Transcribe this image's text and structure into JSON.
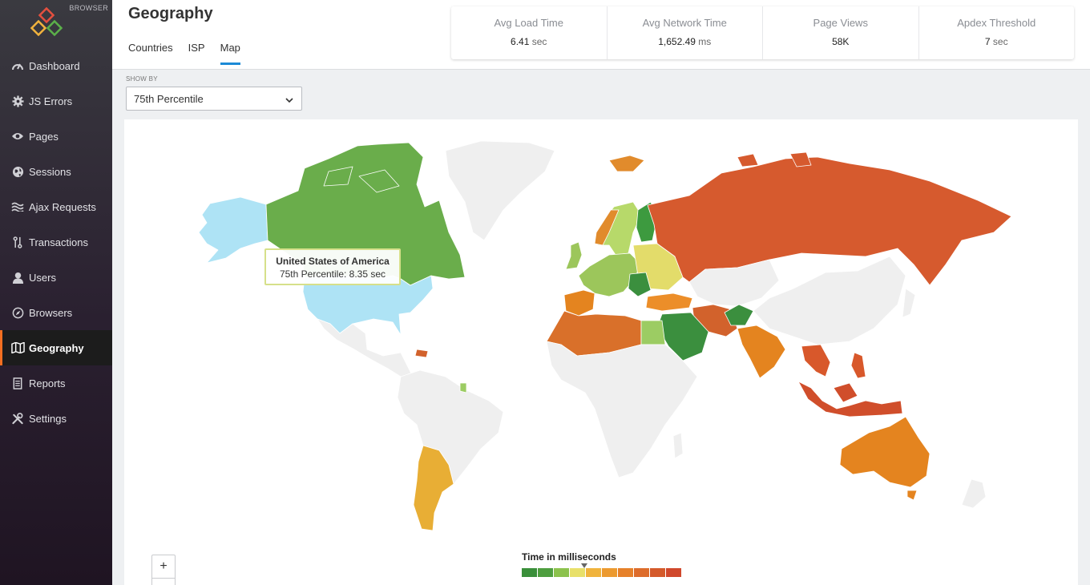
{
  "brand": {
    "tag": "BROWSER"
  },
  "sidebar": {
    "items": [
      {
        "label": "Dashboard",
        "icon": "speedometer-icon"
      },
      {
        "label": "JS Errors",
        "icon": "gear-icon"
      },
      {
        "label": "Pages",
        "icon": "eye-icon"
      },
      {
        "label": "Sessions",
        "icon": "globe-icon"
      },
      {
        "label": "Ajax Requests",
        "icon": "waves-icon"
      },
      {
        "label": "Transactions",
        "icon": "transaction-icon"
      },
      {
        "label": "Users",
        "icon": "user-icon"
      },
      {
        "label": "Browsers",
        "icon": "compass-icon"
      },
      {
        "label": "Geography",
        "icon": "map-icon"
      },
      {
        "label": "Reports",
        "icon": "report-icon"
      },
      {
        "label": "Settings",
        "icon": "tools-icon"
      }
    ],
    "active": "Geography"
  },
  "header": {
    "title": "Geography",
    "tabs": [
      {
        "label": "Countries"
      },
      {
        "label": "ISP"
      },
      {
        "label": "Map"
      }
    ],
    "active_tab": "Map"
  },
  "metrics": [
    {
      "label": "Avg Load Time",
      "value": "6.41",
      "unit": "sec"
    },
    {
      "label": "Avg Network Time",
      "value": "1,652.49",
      "unit": "ms"
    },
    {
      "label": "Page Views",
      "value": "58K",
      "unit": ""
    },
    {
      "label": "Apdex Threshold",
      "value": "7",
      "unit": "sec"
    }
  ],
  "show_by": {
    "label": "SHOW BY",
    "selected": "75th Percentile"
  },
  "tooltip": {
    "country": "United States of America",
    "text": "75th Percentile: 8.35 sec"
  },
  "zoom": {
    "in_label": "+"
  },
  "legend": {
    "title": "Time in milliseconds",
    "colors": [
      "#3a8f3a",
      "#4e9e3f",
      "#8cc24d",
      "#e8e06a",
      "#f0b33c",
      "#ec9a2f",
      "#e6812a",
      "#dd6c2b",
      "#d45a2b",
      "#d0482c"
    ],
    "marker_fraction": 0.39
  },
  "map_colors": {
    "no_data": "#efefef",
    "usa": "#aee3f5",
    "canada": "#6aad4b",
    "russia": "#d65a2e",
    "argentina": "#e8ae35",
    "australia": "#e4841f",
    "india": "#e4841f",
    "saudi": "#3b8f3e",
    "egypt": "#9ccc63",
    "afghanistan": "#3b8f3e",
    "iran": "#d2622c",
    "brazil": "#efefef",
    "africa_north": "#d9702a",
    "scandinavia": "#b7d96a",
    "finland": "#3d9a3f",
    "europe_west": "#9cc65b",
    "europe_east": "#e3dc6a",
    "turkey": "#ec8e29",
    "se_asia": "#d8582b",
    "indonesia": "#d04e2b",
    "greenland": "#efefef",
    "iceland": "#e18b2c"
  }
}
